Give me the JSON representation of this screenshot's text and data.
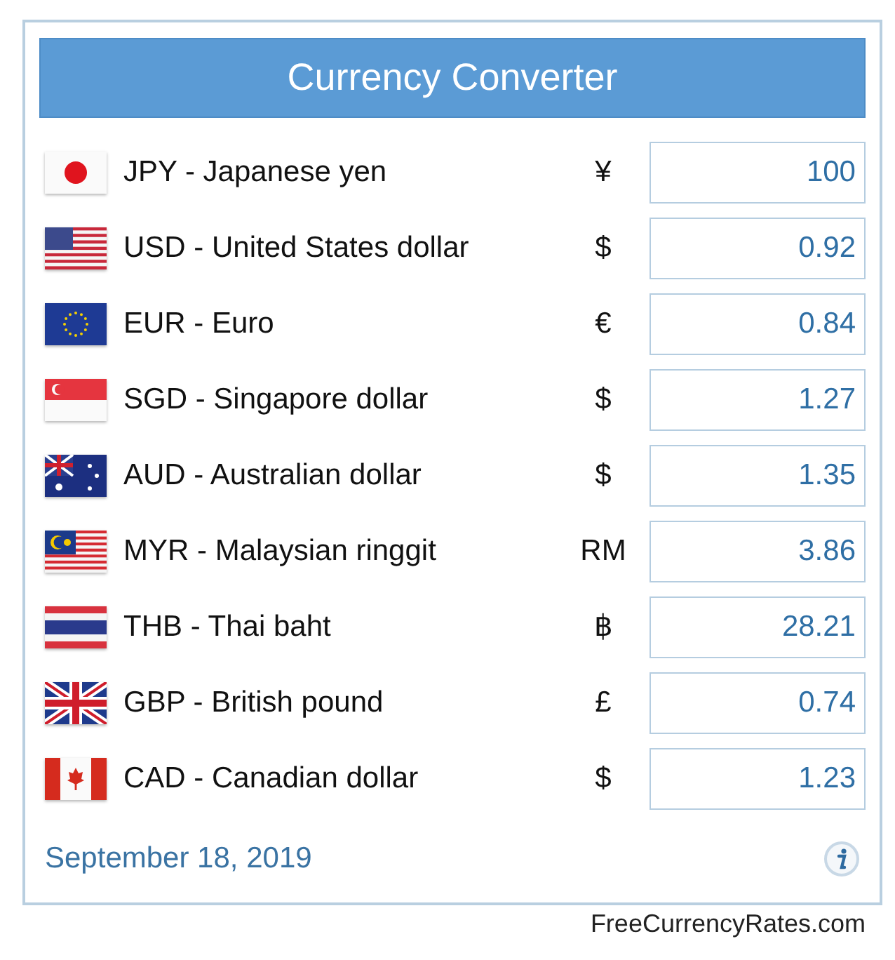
{
  "title": "Currency Converter",
  "currencies": [
    {
      "kind": "jp",
      "name": "JPY - Japanese yen",
      "symbol": "¥",
      "value": "100"
    },
    {
      "kind": "us",
      "name": "USD - United States dollar",
      "symbol": "$",
      "value": "0.92"
    },
    {
      "kind": "eu",
      "name": "EUR - Euro",
      "symbol": "€",
      "value": "0.84"
    },
    {
      "kind": "sg",
      "name": "SGD - Singapore dollar",
      "symbol": "$",
      "value": "1.27"
    },
    {
      "kind": "au",
      "name": "AUD - Australian dollar",
      "symbol": "$",
      "value": "1.35"
    },
    {
      "kind": "my",
      "name": "MYR - Malaysian ringgit",
      "symbol": "RM",
      "value": "3.86"
    },
    {
      "kind": "th",
      "name": "THB - Thai baht",
      "symbol": "฿",
      "value": "28.21"
    },
    {
      "kind": "gb",
      "name": "GBP - British pound",
      "symbol": "£",
      "value": "0.74"
    },
    {
      "kind": "ca",
      "name": "CAD - Canadian dollar",
      "symbol": "$",
      "value": "1.23"
    }
  ],
  "date": "September 18, 2019",
  "credit": "FreeCurrencyRates.com"
}
